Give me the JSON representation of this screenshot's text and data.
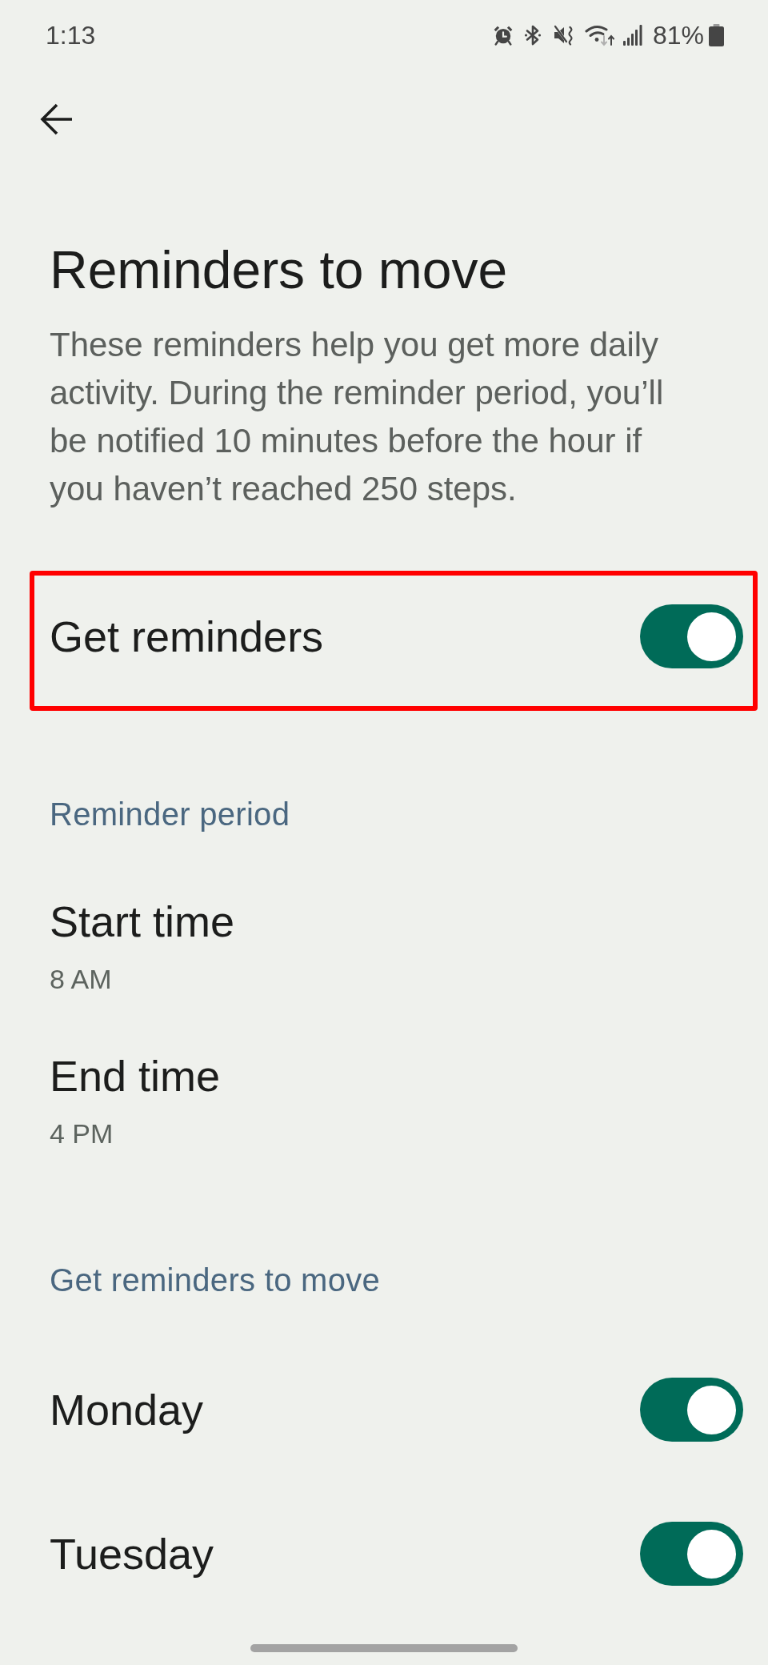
{
  "status_bar": {
    "time": "1:13",
    "battery": "81%"
  },
  "header": {
    "title": "Reminders to move",
    "description": "These reminders help you get more daily activity. During the reminder period, you’ll be notified 10 minutes before the hour if you haven’t reached 250 steps."
  },
  "main_toggle": {
    "label": "Get reminders",
    "on": true,
    "highlighted": true
  },
  "sections": [
    {
      "title": "Reminder period",
      "items": [
        {
          "kind": "value",
          "label": "Start time",
          "value": "8 AM"
        },
        {
          "kind": "value",
          "label": "End time",
          "value": "4 PM"
        }
      ]
    },
    {
      "title": "Get reminders to move",
      "items": [
        {
          "kind": "toggle",
          "label": "Monday",
          "on": true
        },
        {
          "kind": "toggle",
          "label": "Tuesday",
          "on": true
        }
      ]
    }
  ]
}
